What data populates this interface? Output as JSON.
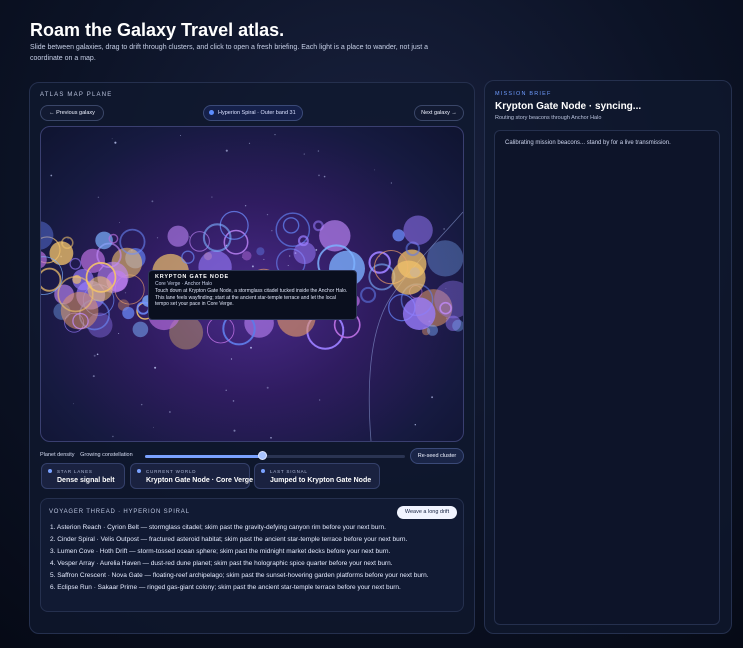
{
  "hero": {
    "title": "Roam the Galaxy Travel atlas.",
    "subtitle": "Slide between galaxies, drag to drift through clusters, and click to open a fresh briefing. Each light is a place to wander, not just a coordinate on a map."
  },
  "atlas": {
    "kicker": "ATLAS MAP PLANE",
    "prev_label": "← Previous galaxy",
    "next_label": "Next galaxy →",
    "location_label": "Hyperion Spiral · Outer band 31",
    "tooltip": {
      "title": "KRYPTON GATE NODE",
      "subtitle": "Core Verge · Anchor Halo",
      "body": "Touch down at Krypton Gate Node, a stormglass citadel tucked inside the Anchor Halo. This lane feels wayfinding; start at the ancient star-temple terrace and let the local tempo set your pace in Core Verge."
    },
    "density_label": "Planet density",
    "density_value_label": "Growing constellation",
    "density_level": 0.45,
    "reseed_label": "Re-seed cluster",
    "stats": [
      {
        "label": "STAR LANES",
        "value": "Dense signal belt"
      },
      {
        "label": "CURRENT WORLD",
        "value": "Krypton Gate Node · Core Verge"
      },
      {
        "label": "LAST SIGNAL",
        "value": "Jumped to Krypton Gate Node"
      }
    ]
  },
  "voyager": {
    "title": "VOYAGER THREAD · HYPERION SPIRAL",
    "weave_label": "Weave a long drift",
    "items": [
      "1. Asterion Reach · Cyrion Belt — stormglass citadel; skim past the gravity-defying canyon rim before your next burn.",
      "2. Cinder Spiral · Velis Outpost — fractured asteroid habitat; skim past the ancient star-temple terrace before your next burn.",
      "3. Lumen Cove · Hoth Drift — storm-tossed ocean sphere; skim past the midnight market decks before your next burn.",
      "4. Vesper Array · Aurelia Haven — dust-red dune planet; skim past the holographic spice quarter before your next burn.",
      "5. Saffron Crescent · Nova Gate — floating-reef archipelago; skim past the sunset-hovering garden platforms before your next burn.",
      "6. Eclipse Run · Sakaar Prime — ringed gas-giant colony; skim past the ancient star-temple terrace before your next burn."
    ]
  },
  "mission": {
    "kicker": "MISSION BRIEF",
    "title": "Krypton Gate Node · syncing...",
    "subtitle": "Routing story beacons through Anchor Halo",
    "body": "Calibrating mission beacons... stand by for a live transmission."
  },
  "colors": {
    "accent": "#6f9cff",
    "background": "#0b1224",
    "map_core": "#4a2a8a"
  }
}
